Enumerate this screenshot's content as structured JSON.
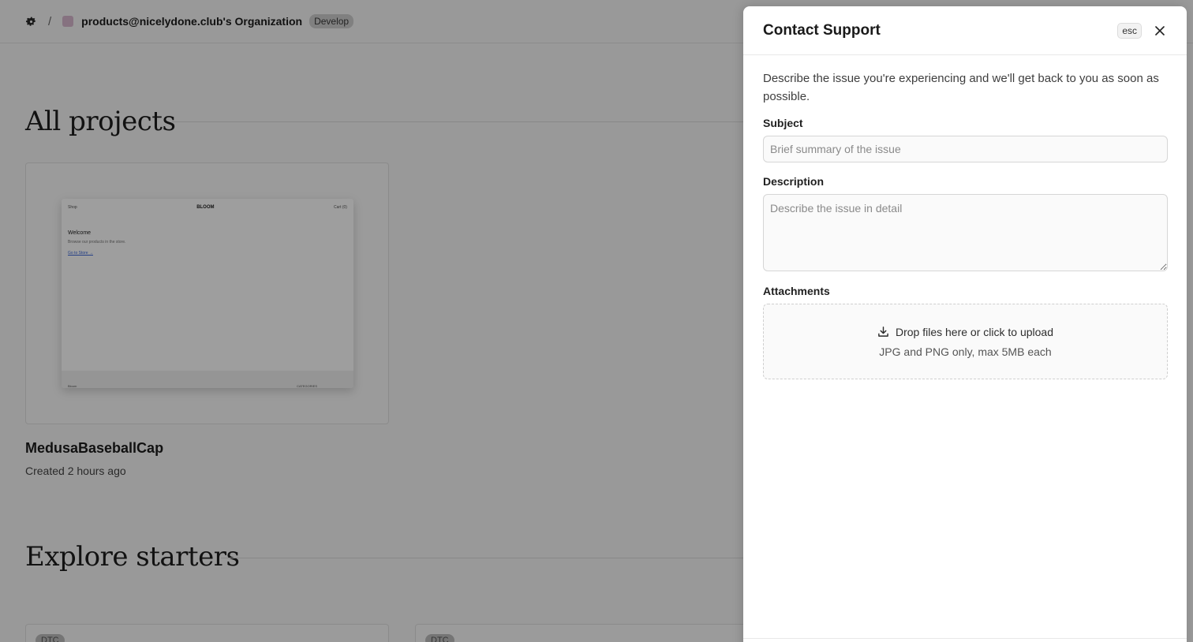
{
  "topbar": {
    "separator": "/",
    "org_name": "products@nicelydone.club's Organization",
    "env_badge": "Develop"
  },
  "sections": {
    "projects_title": "All projects",
    "starters_title": "Explore starters"
  },
  "project": {
    "name": "MedusaBaseballCap",
    "meta": "Created 2 hours ago",
    "preview": {
      "nav_left": "Shop",
      "logo": "BLOOM",
      "nav_right": "Cart (0)",
      "heading": "Welcome",
      "subtext": "Browse our products in the store.",
      "link": "Go to Store →",
      "footer_left": "Bloom",
      "footer_right": "CATEGORIES"
    }
  },
  "starters": [
    {
      "tag": "DTC"
    },
    {
      "tag": "DTC"
    }
  ],
  "drawer": {
    "title": "Contact Support",
    "esc_label": "esc",
    "intro": "Describe the issue you're experiencing and we'll get back to you as soon as possible.",
    "subject_label": "Subject",
    "subject_placeholder": "Brief summary of the issue",
    "subject_value": "",
    "description_label": "Description",
    "description_placeholder": "Describe the issue in detail",
    "description_value": "",
    "attachments_label": "Attachments",
    "dropzone_text": "Drop files here or click to upload",
    "dropzone_hint": "JPG and PNG only, max 5MB each"
  },
  "colors": {
    "overlay": "#000000",
    "accent_link": "#3a67d8"
  }
}
